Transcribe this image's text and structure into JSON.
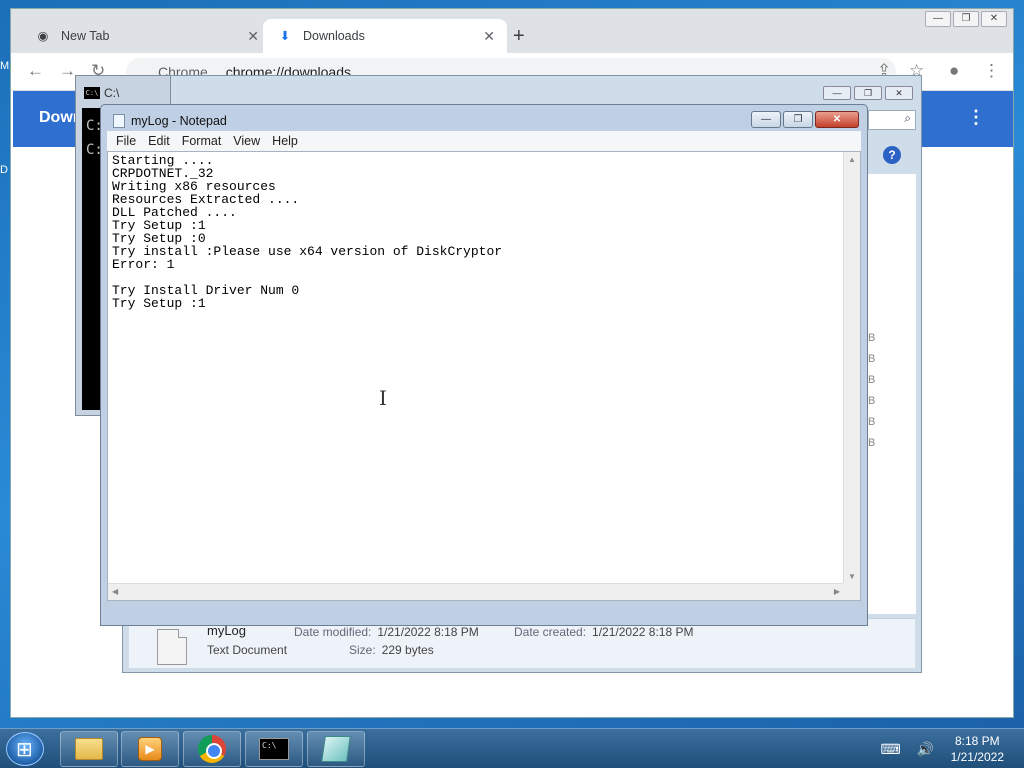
{
  "desktop": {
    "edge_letters": [
      "M",
      "D"
    ]
  },
  "chrome": {
    "tabs": [
      {
        "label": "New Tab",
        "close": "✕"
      },
      {
        "label": "Downloads",
        "close": "✕"
      }
    ],
    "new_tab": "+",
    "window_buttons": [
      "—",
      "❐",
      "✕"
    ],
    "omnibox": {
      "site": "Chrome",
      "url": "chrome://downloads"
    },
    "toolbar_icons": [
      "back-icon",
      "forward-icon",
      "reload-icon",
      "share-icon",
      "star-icon",
      "profile-icon",
      "menu-icon"
    ],
    "page_header": "Down",
    "header_menu": "⋮"
  },
  "explorer": {
    "window_buttons": [
      "—",
      "❐",
      "✕"
    ],
    "help": "?",
    "search_icon": "search-icon",
    "size_column": [
      "B",
      "B",
      "B",
      "B",
      "B",
      "B"
    ],
    "details": {
      "name": "myLog",
      "type": "Text Document",
      "modified_label": "Date modified:",
      "modified_value": "1/21/2022 8:18 PM",
      "created_label": "Date created:",
      "created_value": "1/21/2022 8:18 PM",
      "size_label": "Size:",
      "size_value": "229 bytes"
    }
  },
  "cmd": {
    "title": "C:\\",
    "icon_text": "C:\\",
    "lines": [
      "C:",
      "C:"
    ]
  },
  "notepad": {
    "title": "myLog - Notepad",
    "window_buttons": [
      "—",
      "❐",
      "✕"
    ],
    "menu": [
      "File",
      "Edit",
      "Format",
      "View",
      "Help"
    ],
    "content": "Starting ....\nCRPDOTNET._32\nWriting x86 resources\nResources Extracted ....\nDLL Patched ....\nTry Setup :1\nTry Setup :0\nTry install :Please use x64 version of DiskCryptor\nError: 1\n\nTry Install Driver Num 0\nTry Setup :1",
    "scroll_up": "▲",
    "scroll_down": "▼",
    "scroll_left": "◀",
    "scroll_right": "▶",
    "cursor": "I"
  },
  "taskbar": {
    "items": [
      "explorer-icon",
      "media-player-icon",
      "chrome-icon",
      "cmd-icon",
      "notepad-icon"
    ],
    "cmd_icon_text": "C:\\",
    "tray": "⌨ 🔊",
    "time": "8:18 PM",
    "date": "1/21/2022"
  }
}
